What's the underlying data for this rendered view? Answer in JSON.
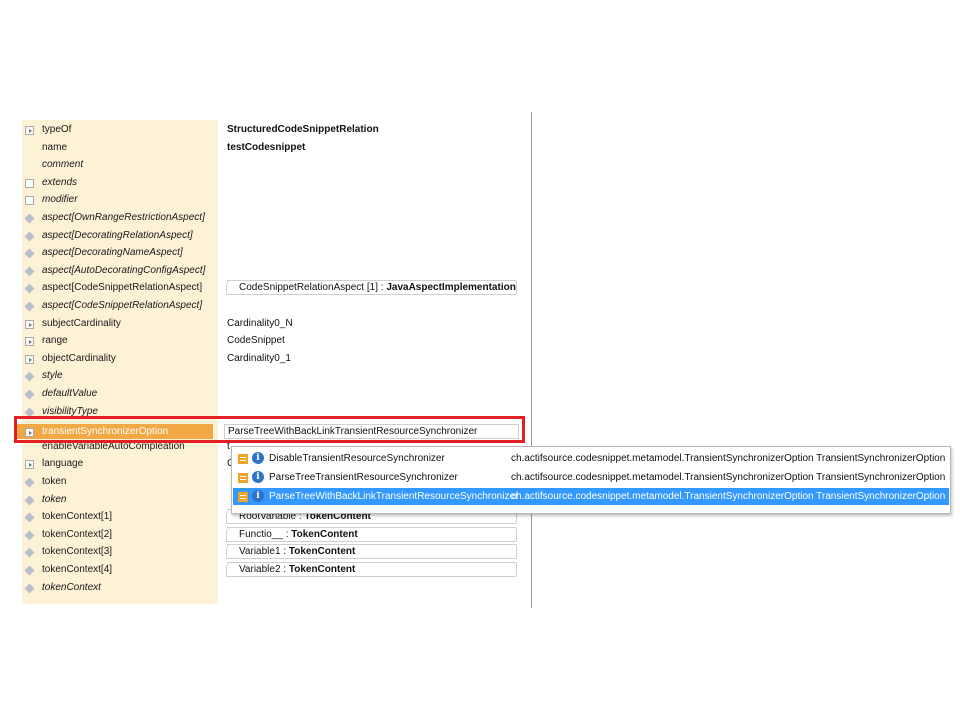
{
  "properties": [
    {
      "label": "typeOf",
      "italic": false,
      "icon": "expand-arrow-icon",
      "value": "StructuredCodeSnippetRelation",
      "value_bold": true
    },
    {
      "label": "name",
      "italic": false,
      "icon": "none",
      "value": "testCodesnippet",
      "value_bold": true
    },
    {
      "label": "comment",
      "italic": true,
      "icon": "none",
      "value": ""
    },
    {
      "label": "extends",
      "italic": true,
      "icon": "checkbox-icon",
      "value": ""
    },
    {
      "label": "modifier",
      "italic": true,
      "icon": "checkbox-icon",
      "value": ""
    },
    {
      "label": "aspect[OwnRangeRestrictionAspect]",
      "italic": true,
      "icon": "diamond-icon",
      "value": ""
    },
    {
      "label": "aspect[DecoratingRelationAspect]",
      "italic": true,
      "icon": "diamond-icon",
      "value": ""
    },
    {
      "label": "aspect[DecoratingNameAspect]",
      "italic": true,
      "icon": "diamond-icon",
      "value": ""
    },
    {
      "label": "aspect[AutoDecoratingConfigAspect]",
      "italic": true,
      "icon": "diamond-icon",
      "value": ""
    },
    {
      "label": "aspect[CodeSnippetRelationAspect]",
      "italic": false,
      "icon": "diamond-icon",
      "chip_name": "CodeSnippetRelationAspect [1] : ",
      "chip_type": "JavaAspectImplementation"
    },
    {
      "label": "aspect[CodeSnippetRelationAspect]",
      "italic": true,
      "icon": "diamond-icon",
      "value": ""
    },
    {
      "label": "subjectCardinality",
      "italic": false,
      "icon": "expand-arrow-icon",
      "value": "Cardinality0_N"
    },
    {
      "label": "range",
      "italic": false,
      "icon": "expand-arrow-icon",
      "value": "CodeSnippet"
    },
    {
      "label": "objectCardinality",
      "italic": false,
      "icon": "expand-arrow-icon",
      "value": "Cardinality0_1"
    },
    {
      "label": "style",
      "italic": true,
      "icon": "diamond-icon",
      "value": ""
    },
    {
      "label": "defaultValue",
      "italic": true,
      "icon": "diamond-icon",
      "value": ""
    },
    {
      "label": "visibilityType",
      "italic": true,
      "icon": "diamond-icon",
      "value": ""
    },
    {
      "label": "transientSynchronizerOption",
      "italic": false,
      "icon": "expand-arrow-icon",
      "value": ""
    },
    {
      "label": "enableVariableAutoCompleation",
      "italic": false,
      "icon": "none",
      "value": "t"
    },
    {
      "label": "language",
      "italic": false,
      "icon": "expand-arrow-icon",
      "value": "C"
    },
    {
      "label": "token",
      "italic": false,
      "icon": "diamond-icon",
      "value": ""
    },
    {
      "label": "token",
      "italic": true,
      "icon": "diamond-icon",
      "value": ""
    },
    {
      "label": "tokenContext[1]",
      "italic": false,
      "icon": "diamond-icon",
      "chip_name": "RootVariable : ",
      "chip_type": "TokenContent"
    },
    {
      "label": "tokenContext[2]",
      "italic": false,
      "icon": "diamond-icon",
      "chip_name": "Functio__ : ",
      "chip_type": "TokenContent"
    },
    {
      "label": "tokenContext[3]",
      "italic": false,
      "icon": "diamond-icon",
      "chip_name": "Variable1 : ",
      "chip_type": "TokenContent"
    },
    {
      "label": "tokenContext[4]",
      "italic": false,
      "icon": "diamond-icon",
      "chip_name": "Variable2 : ",
      "chip_type": "TokenContent"
    },
    {
      "label": "tokenContext",
      "italic": true,
      "icon": "diamond-icon",
      "value": ""
    }
  ],
  "selected_property": {
    "label": "transientSynchronizerOption",
    "value": "ParseTreeWithBackLinkTransientResourceSynchronizer"
  },
  "popup": {
    "options": [
      {
        "name": "DisableTransientResourceSynchronizer",
        "qualifier": "ch.actifsource.codesnippet.metamodel.TransientSynchronizerOption TransientSynchronizerOption",
        "active": false
      },
      {
        "name": "ParseTreeTransientResourceSynchronizer",
        "qualifier": "ch.actifsource.codesnippet.metamodel.TransientSynchronizerOption TransientSynchronizerOption",
        "active": false
      },
      {
        "name": "ParseTreeWithBackLinkTransientResourceSynchronizer",
        "qualifier": "ch.actifsource.codesnippet.metamodel.TransientSynchronizerOption TransientSynchronizerOption",
        "active": true
      }
    ]
  },
  "colors": {
    "label_column": "#fdf1d6",
    "selection": "#f1a845",
    "highlight_box": "#e31e24",
    "popup_active": "#3399ff"
  }
}
